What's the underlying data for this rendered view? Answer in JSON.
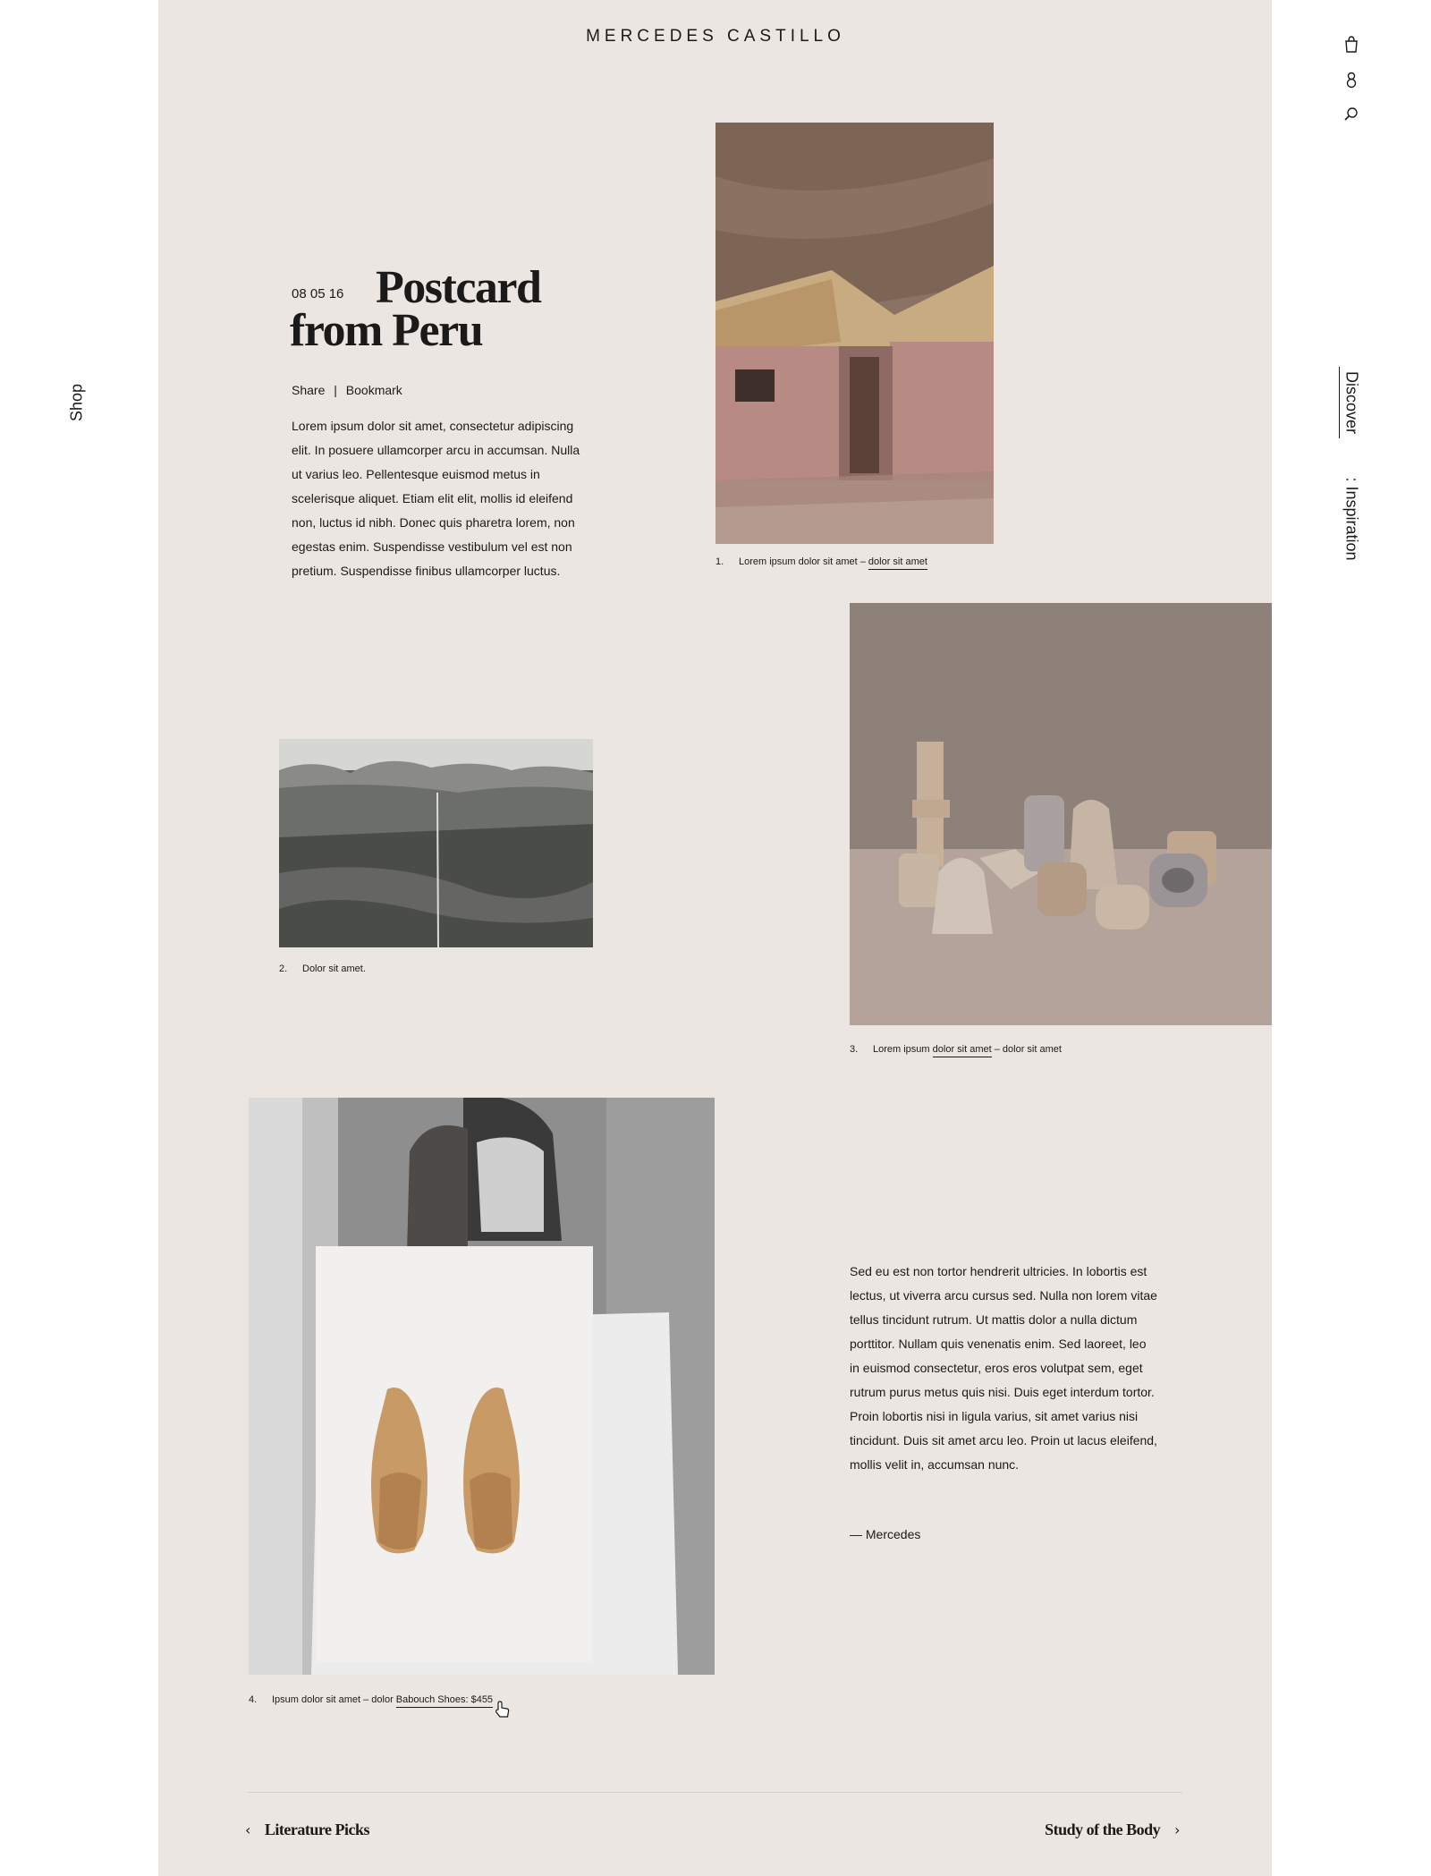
{
  "brand": "MERCEDES CASTILLO",
  "side_nav": {
    "shop": "Shop",
    "discover": "Discover",
    "inspiration": ": Inspiration"
  },
  "header_icons": [
    "shopping-bag-icon",
    "user-icon",
    "search-icon"
  ],
  "article": {
    "date": "08 05 16",
    "title_line1": "Postcard",
    "title_line2": "from Peru",
    "share": "Share",
    "separator": "|",
    "bookmark": "Bookmark",
    "intro": "Lorem ipsum dolor sit amet, consectetur adipiscing elit. In posuere ullamcorper arcu in accumsan. Nulla ut varius leo. Pellentesque euismod metus in scelerisque aliquet. Etiam elit elit, mollis id eleifend non, luctus id nibh. Donec quis pharetra lorem, non egestas enim. Suspendisse vestibulum vel est non pretium. Suspendisse finibus ullamcorper luctus.",
    "body": "Sed eu est non tortor hendrerit ultricies. In lobortis est lectus, ut viverra arcu cursus sed. Nulla non lorem vitae tellus tincidunt rutrum. Ut mattis dolor a nulla dictum porttitor. Nullam quis venenatis enim. Sed laoreet, leo in euismod consectetur, eros eros volutpat sem, eget rutrum purus metus quis nisi. Duis eget interdum tortor. Proin lobortis nisi in ligula varius, sit amet varius nisi tincidunt. Duis sit amet arcu leo. Proin ut lacus eleifend, mollis velit in, accumsan nunc.",
    "signature": "— Mercedes"
  },
  "captions": {
    "c1": {
      "num": "1.",
      "text": "Lorem ipsum dolor sit amet – ",
      "link": "dolor sit amet"
    },
    "c2": {
      "num": "2.",
      "text": "Dolor sit amet."
    },
    "c3": {
      "num": "3.",
      "pre": "Lorem ipsum ",
      "link": "dolor sit amet",
      "post": " – dolor sit amet"
    },
    "c4": {
      "num": "4.",
      "text": "Ipsum dolor sit amet – dolor ",
      "link": "Babouch Shoes: $455"
    }
  },
  "footer_nav": {
    "prev": "Literature Picks",
    "next": "Study of the Body"
  },
  "colors": {
    "page_bg": "#ebe6e1",
    "text": "#1b1a19",
    "shoe": "#c89a66",
    "hut_wall": "#b88a84"
  }
}
